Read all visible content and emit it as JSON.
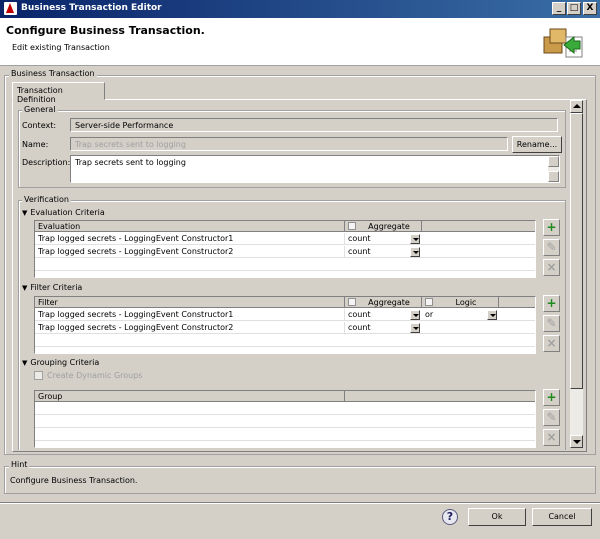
{
  "window": {
    "title": "Business Transaction Editor",
    "buttons": {
      "minimize": "_",
      "maximize": "□",
      "close": "X"
    }
  },
  "header": {
    "title": "Configure Business Transaction.",
    "subtitle": "Edit existing Transaction",
    "icon": "transaction-wizard-icon"
  },
  "business_transaction": {
    "group_label": "Business Transaction",
    "tab_label": "Transaction Definition"
  },
  "general": {
    "group_label": "General",
    "context_label": "Context:",
    "context_value": "Server-side Performance",
    "name_label": "Name:",
    "name_placeholder": "Trap secrets sent to logging",
    "rename_button": "Rename...",
    "description_label": "Description:",
    "description_value": "Trap secrets sent to logging"
  },
  "verification": {
    "group_label": "Verification",
    "evaluation": {
      "section_label": "Evaluation Criteria",
      "columns": [
        "Evaluation",
        "Aggregate"
      ],
      "rows": [
        {
          "name": "Trap logged secrets - LoggingEvent Constructor1",
          "aggregate": "count"
        },
        {
          "name": "Trap logged secrets - LoggingEvent Constructor2",
          "aggregate": "count"
        }
      ]
    },
    "filter": {
      "section_label": "Filter Criteria",
      "columns": [
        "Filter",
        "Aggregate",
        "Logic"
      ],
      "rows": [
        {
          "name": "Trap logged secrets - LoggingEvent Constructor1",
          "aggregate": "count",
          "logic": "or"
        },
        {
          "name": "Trap logged secrets - LoggingEvent Constructor2",
          "aggregate": "count",
          "logic": ""
        }
      ]
    },
    "grouping": {
      "section_label": "Grouping Criteria",
      "checkbox_label": "Create Dynamic Groups",
      "columns": [
        "Group"
      ]
    }
  },
  "hint": {
    "group_label": "Hint",
    "text": "Configure Business Transaction."
  },
  "footer": {
    "help": "?",
    "ok": "Ok",
    "cancel": "Cancel"
  },
  "side_buttons": {
    "add": "+",
    "edit": "✎",
    "remove": "×"
  }
}
